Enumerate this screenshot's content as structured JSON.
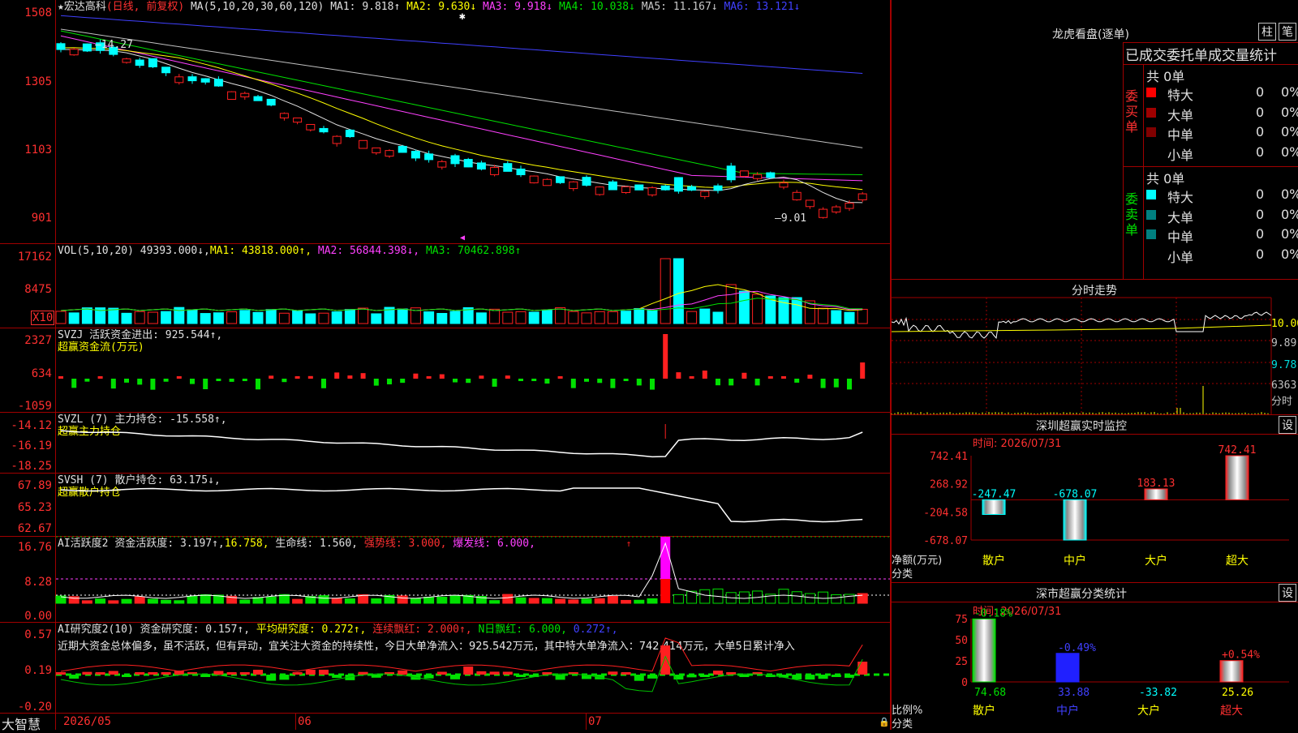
{
  "stock": {
    "name": "宏达高科",
    "mode": "(日线, 前复权)"
  },
  "kline": {
    "y_labels": [
      "1508",
      "1305",
      "1103",
      "901"
    ],
    "ma_header": {
      "label": "MA(5,10,20,30,60,120)",
      "ma1": "MA1: 9.818↑",
      "ma2": "MA2: 9.630↓",
      "ma3": "MA3: 9.918↓",
      "ma4": "MA4: 10.038↓",
      "ma5": "MA5: 11.167↓",
      "ma6": "MA6: 13.121↓"
    },
    "high_label": "14.27",
    "low_label": "9.01",
    "colors": {
      "up": "#ff2020",
      "down": "#00ffff",
      "ma1": "#e0e0e0",
      "ma2": "#ffff00",
      "ma3": "#ff40ff",
      "ma4": "#00e000",
      "ma5": "#c0c0c0",
      "ma6": "#4040ff"
    }
  },
  "vol": {
    "y_labels": [
      "17162",
      "8475"
    ],
    "unit": "X10",
    "header": {
      "label": "VOL(5,10,20)",
      "v": "49393.000↓,",
      "ma1": "MA1: 43818.000↑,",
      "ma2": "MA2: 56844.398↓,",
      "ma3": "MA3: 70462.898↑"
    }
  },
  "svzj": {
    "y_labels": [
      "2327",
      "634",
      "-1059"
    ],
    "title": "SVZJ",
    "line1": "活跃资金进出: 925.544↑,",
    "line2": "超赢资金流(万元)"
  },
  "svzl": {
    "y_labels": [
      "-14.12",
      "-16.19",
      "-18.25"
    ],
    "title": "SVZL (7)",
    "line1": "主力持仓: -15.558↑,",
    "line2": "超赢主力持仓"
  },
  "svsh": {
    "y_labels": [
      "67.89",
      "65.23",
      "62.67"
    ],
    "title": "SVSH (7)",
    "line1": "散户持仓: 63.175↓,",
    "line2": "超赢散户持仓"
  },
  "ai1": {
    "y_labels": [
      "16.76",
      "8.28",
      "0.00"
    ],
    "title": "AI活跃度2",
    "v1": "资金活跃度: 3.197↑,",
    "v2": "16.758,",
    "v3": "生命线: 1.560,",
    "v4": "强势线: 3.000,",
    "v5": "爆发线: 6.000,"
  },
  "ai2": {
    "y_labels": [
      "0.57",
      "0.19",
      "-0.20"
    ],
    "title": "AI研究度2(10)",
    "v1": "资金研究度: 0.157↑,",
    "v2": "平均研究度: 0.272↑,",
    "v3": "连续飘红: 2.000↑,",
    "v4": "N日飘红: 6.000,",
    "v5": "0.272↑,",
    "text": "近期大资金总体偏多，虽不活跃，但有异动，宜关注大资金的持续性，今日大单净流入：925.542万元，其中特大单净流入：742.414万元，大单5日累计净入"
  },
  "xaxis": {
    "brand": "大智慧",
    "labels": [
      "2026/05",
      "06",
      "07"
    ]
  },
  "lhkp": {
    "title": "龙虎看盘(逐单)",
    "btn1": "柱",
    "btn2": "笔",
    "header": "已成交委托单成交量统计",
    "buy_label": "委买单",
    "sell_label": "委卖单",
    "buy_total": "共 0单",
    "sell_total": "共 0单",
    "buy_rows": [
      {
        "name": "特大",
        "count": "0",
        "pct": "0%"
      },
      {
        "name": "大单",
        "count": "0",
        "pct": "0%"
      },
      {
        "name": "中单",
        "count": "0",
        "pct": "0%"
      },
      {
        "name": "小单",
        "count": "0",
        "pct": "0%"
      }
    ],
    "sell_rows": [
      {
        "name": "特大",
        "count": "0",
        "pct": "0%"
      },
      {
        "name": "大单",
        "count": "0",
        "pct": "0%"
      },
      {
        "name": "中单",
        "count": "0",
        "pct": "0%"
      },
      {
        "name": "小单",
        "count": "0",
        "pct": "0%"
      }
    ],
    "colors": {
      "buy1": "#ff0000",
      "buy2": "#a00000",
      "buy3": "#800000",
      "sell1": "#00ffff",
      "sell2": "#008080",
      "sell3": "#008080"
    }
  },
  "fsz": {
    "title": "分时走势",
    "right_labels": [
      "10.00",
      "9.89",
      "9.78",
      "6363",
      "分时"
    ]
  },
  "szss": {
    "title": "深圳超赢实时监控",
    "btn": "设",
    "time": "时间: 2026/07/31",
    "y_labels": [
      "742.41",
      "268.92",
      "-204.58",
      "-678.07"
    ],
    "ylabel1": "净额(万元)",
    "ylabel2": "分类",
    "bars": [
      {
        "name": "散户",
        "value": -247.47,
        "label": "-247.47"
      },
      {
        "name": "中户",
        "value": -678.07,
        "label": "-678.07"
      },
      {
        "name": "大户",
        "value": 183.13,
        "label": "183.13"
      },
      {
        "name": "超大",
        "value": 742.41,
        "label": "742.41"
      }
    ]
  },
  "sscf": {
    "title": "深市超赢分类统计",
    "btn": "设",
    "time": "时间: 2026/07/31",
    "y_labels": [
      "75",
      "50",
      "25",
      "0"
    ],
    "ylabel1": "比例%",
    "ylabel2": "分类",
    "bars": [
      {
        "name": "散户",
        "value": 74.68,
        "label": "74.68",
        "change": "-0.18%"
      },
      {
        "name": "中户",
        "value": 33.88,
        "label": "33.88",
        "change": "-0.49%"
      },
      {
        "name": "大户",
        "value": -33.82,
        "label": "-33.82",
        "change": ""
      },
      {
        "name": "超大",
        "value": 25.26,
        "label": "25.26",
        "change": "+0.54%"
      }
    ]
  }
}
